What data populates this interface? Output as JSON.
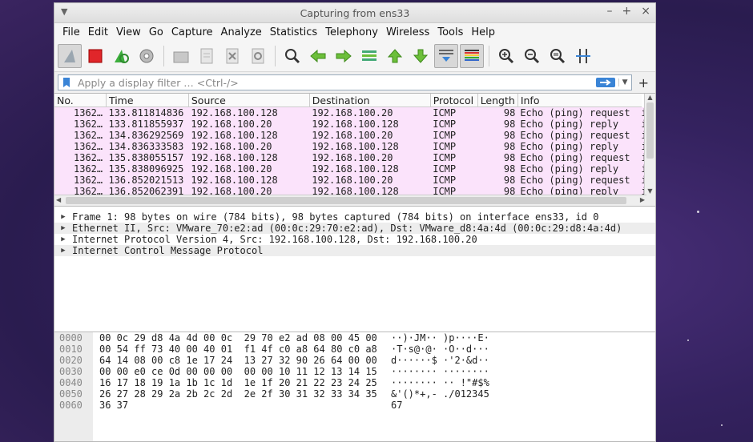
{
  "window": {
    "title": "Capturing from ens33",
    "controls": [
      "–",
      "+",
      "×"
    ]
  },
  "menu": [
    "File",
    "Edit",
    "View",
    "Go",
    "Capture",
    "Analyze",
    "Statistics",
    "Telephony",
    "Wireless",
    "Tools",
    "Help"
  ],
  "toolbar": {
    "icons": [
      "shark-fin-start-icon",
      "stop-capture-icon",
      "restart-capture-icon",
      "capture-options-icon",
      "open-file-icon",
      "save-file-icon",
      "close-file-icon",
      "reload-file-icon",
      "find-packet-icon",
      "go-back-icon",
      "go-forward-icon",
      "go-to-packet-icon",
      "first-packet-icon",
      "last-packet-icon",
      "auto-scroll-icon",
      "colorize-icon",
      "zoom-in-icon",
      "zoom-out-icon",
      "normal-size-icon",
      "resize-columns-icon"
    ]
  },
  "filter": {
    "placeholder": "Apply a display filter … <Ctrl-/>",
    "value": ""
  },
  "packet_list": {
    "columns": [
      "No.",
      "Time",
      "Source",
      "Destination",
      "Protocol",
      "Length",
      "Info"
    ],
    "rows": [
      [
        "1362…",
        "133.811814836",
        "192.168.100.128",
        "192.168.100.20",
        "ICMP",
        "98",
        "Echo (ping) request",
        "id"
      ],
      [
        "1362…",
        "133.811855937",
        "192.168.100.20",
        "192.168.100.128",
        "ICMP",
        "98",
        "Echo (ping) reply",
        "id"
      ],
      [
        "1362…",
        "134.836292569",
        "192.168.100.128",
        "192.168.100.20",
        "ICMP",
        "98",
        "Echo (ping) request",
        "id"
      ],
      [
        "1362…",
        "134.836333583",
        "192.168.100.20",
        "192.168.100.128",
        "ICMP",
        "98",
        "Echo (ping) reply",
        "id"
      ],
      [
        "1362…",
        "135.838055157",
        "192.168.100.128",
        "192.168.100.20",
        "ICMP",
        "98",
        "Echo (ping) request",
        "id"
      ],
      [
        "1362…",
        "135.838096925",
        "192.168.100.20",
        "192.168.100.128",
        "ICMP",
        "98",
        "Echo (ping) reply",
        "id"
      ],
      [
        "1362…",
        "136.852021513",
        "192.168.100.128",
        "192.168.100.20",
        "ICMP",
        "98",
        "Echo (ping) request",
        "id"
      ],
      [
        "1362…",
        "136.852062391",
        "192.168.100.20",
        "192.168.100.128",
        "ICMP",
        "98",
        "Echo (ping) reply",
        "id"
      ]
    ]
  },
  "details": [
    "Frame 1: 98 bytes on wire (784 bits), 98 bytes captured (784 bits) on interface ens33, id 0",
    "Ethernet II, Src: VMware_70:e2:ad (00:0c:29:70:e2:ad), Dst: VMware_d8:4a:4d (00:0c:29:d8:4a:4d)",
    "Internet Protocol Version 4, Src: 192.168.100.128, Dst: 192.168.100.20",
    "Internet Control Message Protocol"
  ],
  "bytes": [
    {
      "offset": "0000",
      "hex": "00 0c 29 d8 4a 4d 00 0c  29 70 e2 ad 08 00 45 00",
      "ascii": "··)·JM·· )p····E·"
    },
    {
      "offset": "0010",
      "hex": "00 54 ff 73 40 00 40 01  f1 4f c0 a8 64 80 c0 a8",
      "ascii": "·T·s@·@· ·O··d···"
    },
    {
      "offset": "0020",
      "hex": "64 14 08 00 c8 1e 17 24  13 27 32 90 26 64 00 00",
      "ascii": "d······$ ·'2·&d··"
    },
    {
      "offset": "0030",
      "hex": "00 00 e0 ce 0d 00 00 00  00 00 10 11 12 13 14 15",
      "ascii": "········ ········"
    },
    {
      "offset": "0040",
      "hex": "16 17 18 19 1a 1b 1c 1d  1e 1f 20 21 22 23 24 25",
      "ascii": "········ ·· !\"#$%"
    },
    {
      "offset": "0050",
      "hex": "26 27 28 29 2a 2b 2c 2d  2e 2f 30 31 32 33 34 35",
      "ascii": "&'()*+,- ./012345"
    },
    {
      "offset": "0060",
      "hex": "36 37",
      "ascii": "67"
    }
  ],
  "colors": {
    "row_bg": "#fbe3fb",
    "accent": "#3a84d6",
    "desktop": "#34225f"
  }
}
